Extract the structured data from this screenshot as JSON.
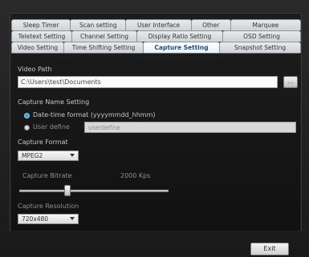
{
  "tabs": {
    "row1": [
      "Sleep Timer",
      "Scan setting",
      "User Interface",
      "Other",
      "Marquee"
    ],
    "row2": [
      "Teletext Setting",
      "Channel Setting",
      "Display Ratio Setting",
      "OSD Setting"
    ],
    "row3": [
      "Video Setting",
      "Time Shifting Setting",
      "Capture Setting",
      "Snapshot Setting"
    ],
    "active": "Capture Setting"
  },
  "video_path": {
    "label": "Video Path",
    "value": "C:\\Users\\test\\Documents",
    "browse_label": "..."
  },
  "capture_name": {
    "label": "Capture Name Setting",
    "option_datetime": "Date-time format (yyyymmdd_hhmm)",
    "option_user": "User define",
    "user_placeholder": "userdefine",
    "selected": "datetime"
  },
  "capture_format": {
    "label": "Capture Format",
    "value": "MPEG2"
  },
  "capture_bitrate": {
    "label": "Capture Bitrate",
    "value_text": "2000 Kps",
    "slider_fraction": 0.32
  },
  "capture_resolution": {
    "label": "Capture Resolution",
    "value": "720x480"
  },
  "footer": {
    "exit_label": "Exit"
  }
}
